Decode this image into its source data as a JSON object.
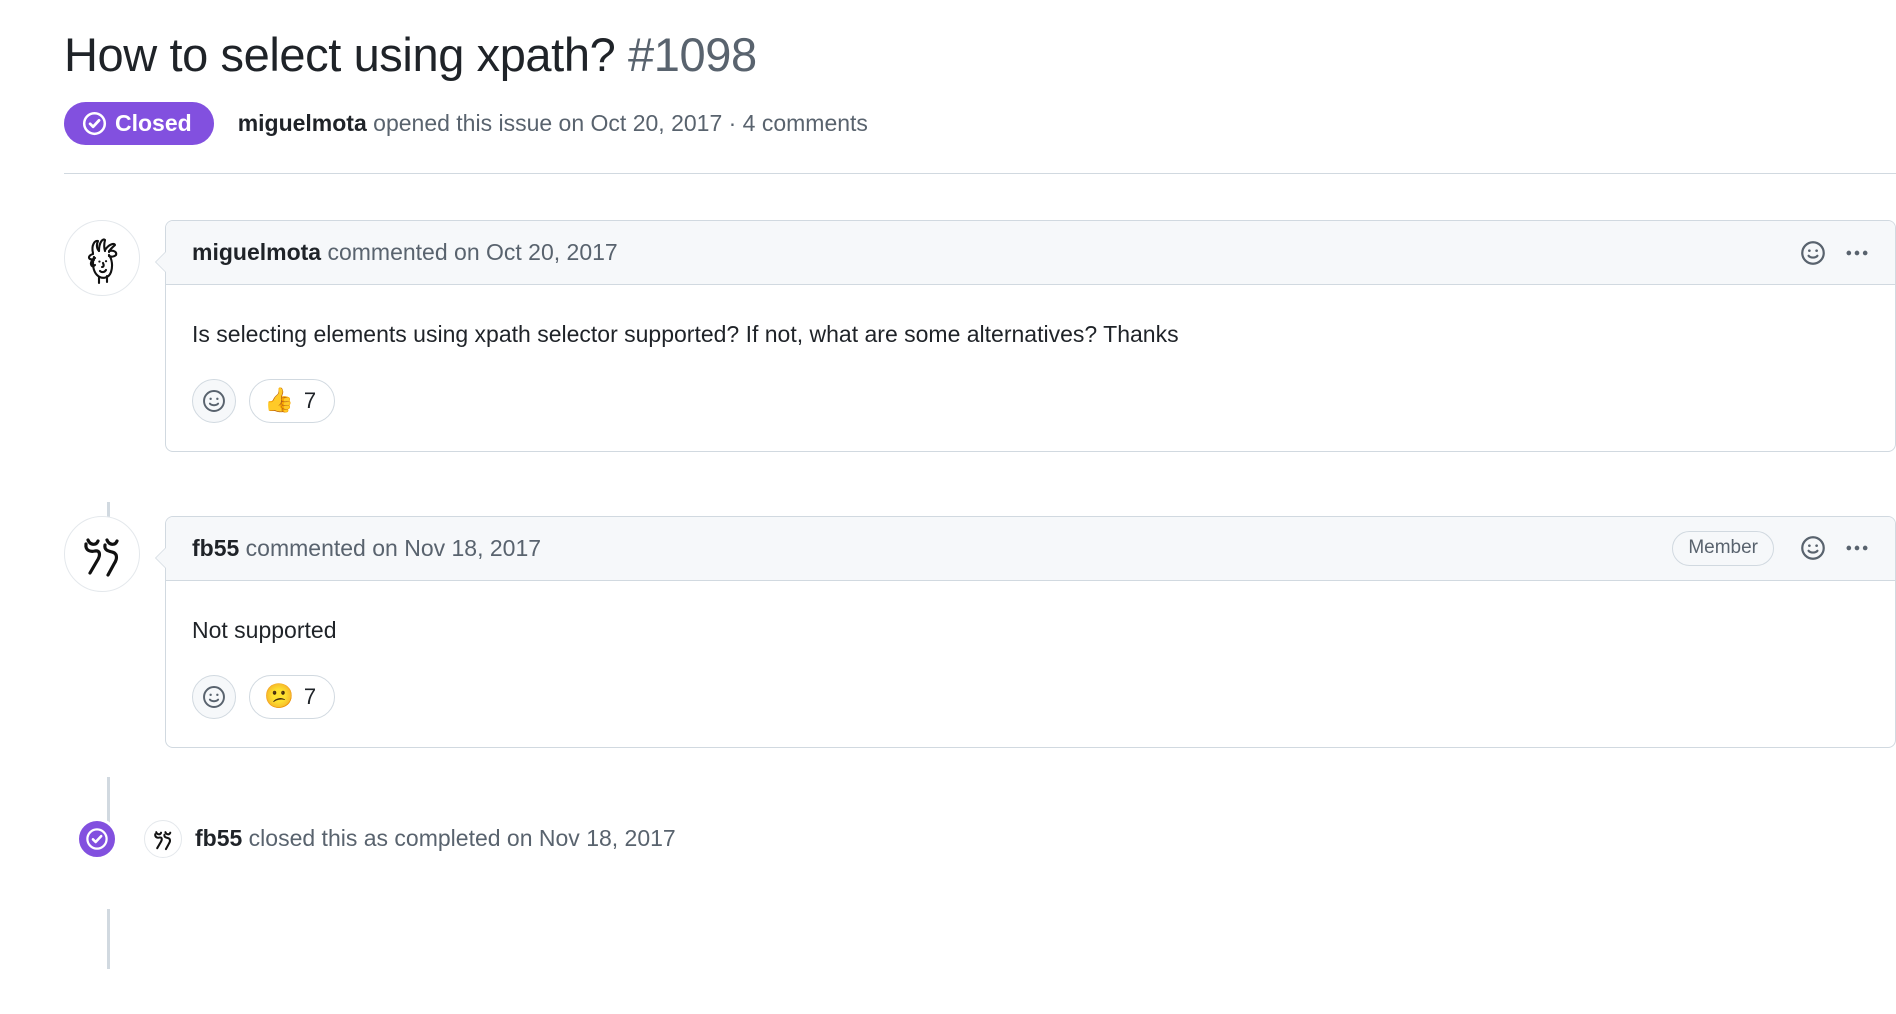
{
  "issue": {
    "title": "How to select using xpath?",
    "number": "#1098",
    "state_label": "Closed",
    "state_color": "#8250df",
    "byline_author": "miguelmota",
    "byline_rest": " opened this issue on Oct 20, 2017 · 4 comments"
  },
  "comments": [
    {
      "author": "miguelmota",
      "meta": " commented on Oct 20, 2017",
      "badge": "",
      "body": "Is selecting elements using xpath selector supported? If not, what are some alternatives? Thanks",
      "reactions": {
        "add_icon": "smiley-face-icon",
        "emoji": "👍",
        "count": "7"
      },
      "actions": {
        "react_icon": "smiley-face-icon",
        "menu_icon": "kebab-horizontal-icon"
      }
    },
    {
      "author": "fb55",
      "meta": " commented on Nov 18, 2017",
      "badge": "Member",
      "body": "Not supported",
      "reactions": {
        "add_icon": "smiley-face-icon",
        "emoji": "😕",
        "count": "7"
      },
      "actions": {
        "react_icon": "smiley-face-icon",
        "menu_icon": "kebab-horizontal-icon"
      }
    }
  ],
  "closed_event": {
    "author": "fb55",
    "text": " closed this as completed on Nov 18, 2017",
    "icon": "issue-closed-check-icon",
    "icon_color": "#8250df"
  }
}
